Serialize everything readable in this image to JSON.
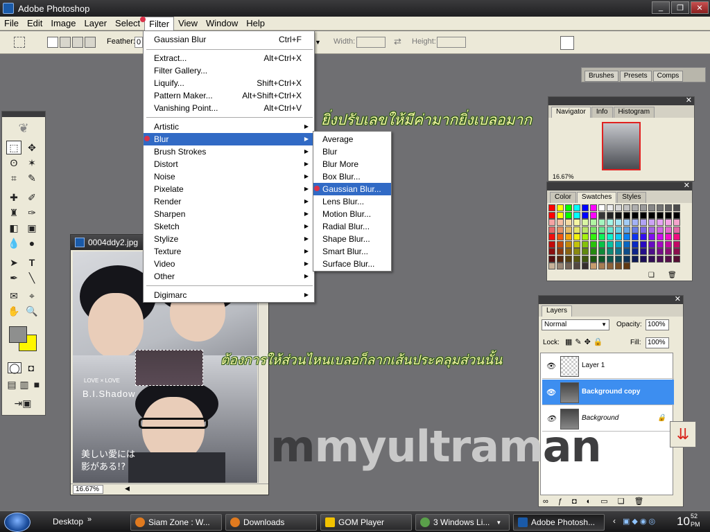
{
  "app": {
    "title": "Adobe Photoshop"
  },
  "window_controls": {
    "minimize": "_",
    "restore": "❐",
    "close": "✕"
  },
  "menubar": [
    "File",
    "Edit",
    "Image",
    "Layer",
    "Select",
    "Filter",
    "View",
    "Window",
    "Help"
  ],
  "options_bar": {
    "feather_label": "Feather:",
    "feather_value": "0",
    "width_label": "Width:",
    "height_label": "Height:",
    "panel_well_tabs": [
      "Brushes",
      "Presets",
      "Comps"
    ]
  },
  "filter_menu": {
    "items": [
      {
        "label": "Gaussian Blur",
        "shortcut": "Ctrl+F"
      },
      {
        "label": "Extract...",
        "shortcut": "Alt+Ctrl+X"
      },
      {
        "label": "Filter Gallery...",
        "shortcut": ""
      },
      {
        "label": "Liquify...",
        "shortcut": "Shift+Ctrl+X"
      },
      {
        "label": "Pattern Maker...",
        "shortcut": "Alt+Shift+Ctrl+X"
      },
      {
        "label": "Vanishing Point...",
        "shortcut": "Alt+Ctrl+V"
      }
    ],
    "submenus": [
      "Artistic",
      "Blur",
      "Brush Strokes",
      "Distort",
      "Noise",
      "Pixelate",
      "Render",
      "Sharpen",
      "Sketch",
      "Stylize",
      "Texture",
      "Video",
      "Other"
    ],
    "last": "Digimarc",
    "highlighted": "Blur"
  },
  "blur_menu": {
    "items": [
      "Average",
      "Blur",
      "Blur More",
      "Box Blur...",
      "Gaussian Blur...",
      "Lens Blur...",
      "Motion Blur...",
      "Radial Blur...",
      "Shape Blur...",
      "Smart Blur...",
      "Surface Blur..."
    ],
    "highlighted": "Gaussian Blur..."
  },
  "document": {
    "title": "0004ddy2.jpg",
    "zoom": "16.67%",
    "magazine_text": [
      "LOVE × LOVE",
      "B.I.Shadow",
      "美しい愛には",
      "影がある!?"
    ]
  },
  "navigator": {
    "tabs": [
      "Navigator",
      "Info",
      "Histogram"
    ],
    "zoom": "16.67%"
  },
  "swatches": {
    "tabs": [
      "Color",
      "Swatches",
      "Styles"
    ]
  },
  "layers": {
    "tab": "Layers",
    "blend_mode": "Normal",
    "opacity_label": "Opacity:",
    "opacity": "100%",
    "lock_label": "Lock:",
    "fill_label": "Fill:",
    "fill": "100%",
    "items": [
      {
        "name": "Layer 1"
      },
      {
        "name": "Background copy"
      },
      {
        "name": "Background"
      }
    ]
  },
  "annotations": {
    "top": "ยิ่งปรับเลขให้มีค่ามากยิ่งเบลอมาก",
    "middle": "ต้องการให้ส่วนไหนเบลอก็ลากเส้นประคลุมส่วนนั้น"
  },
  "watermark": {
    "light1": "my",
    "light2": "ultram",
    "dark1": "m",
    "dark2": "an"
  },
  "taskbar": {
    "desktop": "Desktop",
    "items": [
      "Siam Zone : W...",
      "Downloads",
      "GOM Player",
      "3 Windows Li...",
      "Adobe Photosh..."
    ],
    "clock_time": "10",
    "clock_minutes": "52",
    "clock_ampm": "PM"
  }
}
